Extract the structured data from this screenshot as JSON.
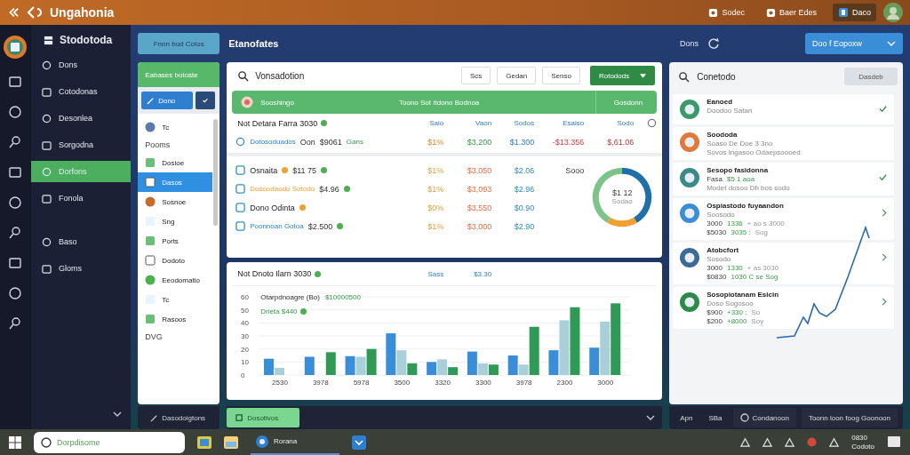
{
  "top_bar": {
    "title": "Ungahonia",
    "actions": [
      "Sodec",
      "Baer Edes"
    ],
    "account_button": "Daco"
  },
  "sidebar": {
    "title": "Stodotoda",
    "items": [
      {
        "label": "Dons",
        "selected": false
      },
      {
        "label": "Cotodonas",
        "selected": false
      },
      {
        "label": "Desonlea",
        "selected": false
      },
      {
        "label": "Sorgodna",
        "selected": false
      },
      {
        "label": "Dorfons",
        "selected": true
      },
      {
        "label": "Fonola",
        "selected": false
      },
      {
        "label": "Baso",
        "selected": false
      },
      {
        "label": "Gloms",
        "selected": false
      }
    ]
  },
  "header": {
    "primary_button": "Fnnn bod Cotos",
    "title": "Etanofates",
    "status_label": "Dons",
    "dropdown": "Doo f Eopoxw"
  },
  "filter_panel": {
    "header": "Eabases botoste",
    "button": "Dono",
    "items": [
      {
        "kind": "item",
        "label": "Tc",
        "selected": false
      },
      {
        "kind": "heading",
        "label": "Pooms"
      },
      {
        "kind": "item",
        "label": "Dosioe",
        "selected": false
      },
      {
        "kind": "item",
        "label": "Dasos",
        "selected": true
      },
      {
        "kind": "item",
        "label": "Sosnoe",
        "selected": false
      },
      {
        "kind": "item",
        "label": "Sng",
        "selected": false
      },
      {
        "kind": "item",
        "label": "Ports",
        "selected": false
      },
      {
        "kind": "item",
        "label": "Dodoto",
        "selected": false
      },
      {
        "kind": "item",
        "label": "Eeodomatio",
        "selected": false
      },
      {
        "kind": "item",
        "label": "Tc",
        "selected": false
      },
      {
        "kind": "item",
        "label": "Rasoos",
        "selected": false
      },
      {
        "kind": "heading",
        "label": "DVG"
      }
    ],
    "footer": "Dasodoigtons"
  },
  "summary_panel": {
    "title": "Vonsadotion",
    "buttons": [
      "Scs",
      "Gedan",
      "Senso"
    ],
    "dropdown": "Rotodods",
    "banner": {
      "title": "Sooshingo",
      "text": "Toono Sot Itdono Bodnoa",
      "action": "Gosdonn"
    },
    "table": {
      "caption": "Not Detara Farra 3030",
      "columns": [
        "Saio",
        "Vaon",
        "Sodos",
        "Esaiso",
        "Sodo"
      ],
      "rows": [
        {
          "kind": "link",
          "name": "Dotosoduados",
          "prefix": "Oon",
          "amount": "$9061",
          "tag": "Gans",
          "name_dot": false,
          "amount_dot": false,
          "values": [
            "$1%",
            "$3,200",
            "$1.300",
            "-$13.356",
            "$,61.06"
          ]
        },
        {
          "kind": "plain",
          "name": "Osnaita",
          "amount": "$11 75",
          "name_dot": true,
          "amount_dot": true,
          "values": [
            "$1%",
            "$3,050",
            "$2.06",
            "Sooo"
          ]
        },
        {
          "kind": "warning",
          "name": "Dosoodaodo Sotodo",
          "amount": "$4.96",
          "name_dot": false,
          "amount_dot": true,
          "values": [
            "$1%",
            "$3,093",
            "$2.96"
          ]
        },
        {
          "kind": "plain",
          "name": "Dono Odinta",
          "name_dot": true,
          "amount_dot": false,
          "values": [
            "$0%",
            "$3,550",
            "$0.90"
          ]
        },
        {
          "kind": "link",
          "name": "Poonnoan Gotoa",
          "amount": "$2.500",
          "name_dot": false,
          "amount_dot": true,
          "values": [
            "$1%",
            "$3,000",
            "$2.90"
          ]
        }
      ]
    },
    "donut": {
      "value": "$1 12",
      "label": "Sodao"
    }
  },
  "chart_panel": {
    "caption": "Not Dnoto Ilarn 3030",
    "columns": [
      "Sass",
      "$3.30"
    ],
    "legend_title": "Otarpdnoagre (Bo)",
    "legend_value": "$10000500",
    "sub_label": "Drieta $440",
    "chart_data": {
      "type": "bar",
      "categories": [
        "2530",
        "3978",
        "5978",
        "3500",
        "3320",
        "3300",
        "3978",
        "2300",
        "3000"
      ],
      "ylim": [
        0,
        60
      ],
      "grid": true,
      "yticks": [
        0,
        10,
        20,
        30,
        40,
        50,
        60
      ],
      "series": [
        {
          "color": "#3a8ed8",
          "values": [
            12.5,
            14,
            14.5,
            32,
            10,
            18,
            15,
            19,
            21
          ]
        },
        {
          "color": "#a9cfd9",
          "values": [
            5.5,
            null,
            14,
            19,
            12,
            9,
            8,
            42,
            41
          ]
        },
        {
          "color": "#2e9a55",
          "values": [
            null,
            17.5,
            20,
            9,
            6,
            8,
            37,
            52,
            55
          ]
        }
      ]
    }
  },
  "footer_button": "Dosotivos",
  "details_panel": {
    "title": "Conetodo",
    "button": "Dasdeb",
    "cards": [
      {
        "title": "Eanoed",
        "color": "#3a9a6a",
        "kind": "check",
        "lines": [
          [
            "Doodoo Satan"
          ]
        ]
      },
      {
        "title": "Soododa",
        "color": "#e07a3a",
        "kind": "plain",
        "lines": [
          [
            "Soaso De Doe 3 3no"
          ],
          [
            "Sovos Ingasoo Odaepsoooed"
          ]
        ]
      },
      {
        "title": "Sesopo fasidonna",
        "color": "#3a8a8a",
        "kind": "check",
        "lines": [
          [
            "Fasa",
            "$5 1 aoa"
          ],
          [
            "Modet dosoo Dh bos sodo"
          ]
        ]
      },
      {
        "title": "Ospiastodo fuyaandon",
        "color": "#3a8ed8",
        "kind": "chevron",
        "lines": [
          [
            "Soosodo"
          ],
          [
            "3000",
            "1336",
            "+ ao s 3000"
          ],
          [
            "$5030",
            "3035 :",
            "Sog"
          ]
        ]
      },
      {
        "title": "Atobcfort",
        "color": "#3a6a9a",
        "kind": "chevron",
        "lines": [
          [
            "Sosodo"
          ],
          [
            "3000",
            "1330",
            "+ as 3030"
          ],
          [
            "$0830",
            "1030 C se Sog"
          ]
        ]
      },
      {
        "title": "Sosopiotanam Esicin",
        "color": "#2e8a4a",
        "kind": "chevron",
        "lines": [
          [
            "Doso Sogosoo"
          ],
          [
            "$900",
            "+330 :",
            "So"
          ],
          [
            "$200",
            "+8000",
            "Soy"
          ]
        ]
      }
    ],
    "footer": [
      "Apn",
      "SBa",
      "Condanoon",
      "Toonn loon foog Goonoon"
    ]
  },
  "taskbar": {
    "search_placeholder": "Dorpdisome",
    "app": "Rorana",
    "clock": [
      "0830",
      "Codoto"
    ]
  }
}
